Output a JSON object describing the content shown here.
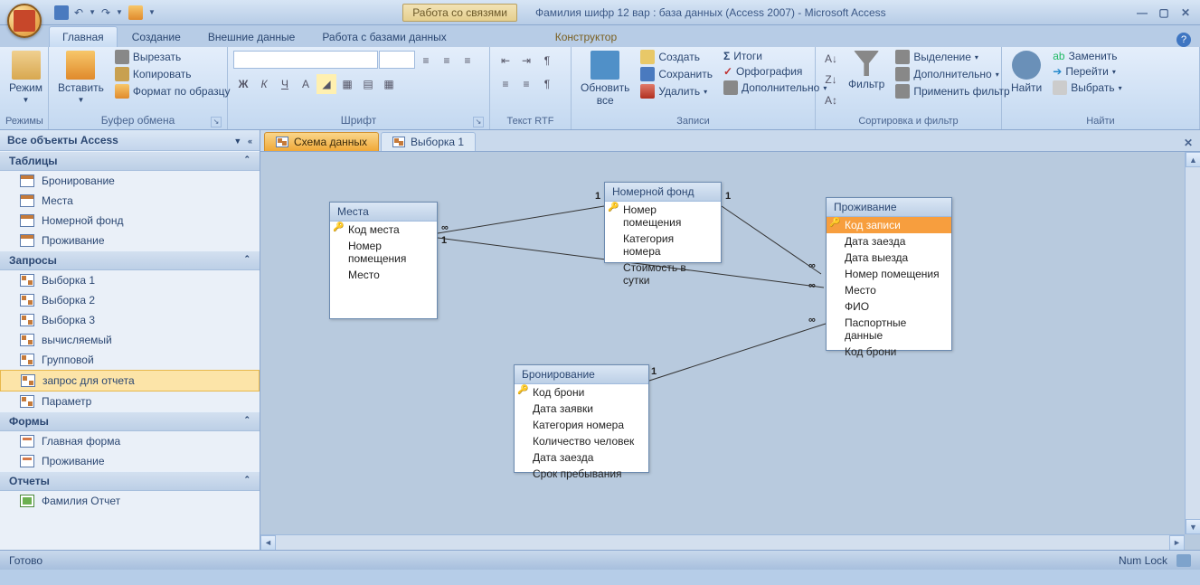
{
  "qat": {
    "save": "save-icon",
    "undo": "↶",
    "redo": "↷",
    "open": "open-icon"
  },
  "context_group": "Работа со связями",
  "app_title": "Фамилия шифр 12 вар : база данных (Access 2007)  -  Microsoft Access",
  "ribbon_tabs": [
    "Главная",
    "Создание",
    "Внешние данные",
    "Работа с базами данных"
  ],
  "ribbon_contextual": "Конструктор",
  "groups": {
    "modes": {
      "label": "Режимы",
      "btn": "Режим"
    },
    "clipboard": {
      "label": "Буфер обмена",
      "paste": "Вставить",
      "cut": "Вырезать",
      "copy": "Копировать",
      "fmt": "Формат по образцу"
    },
    "font": {
      "label": "Шрифт"
    },
    "rtf": {
      "label": "Текст RTF"
    },
    "records": {
      "label": "Записи",
      "refresh": "Обновить\nвсе",
      "new": "Создать",
      "save": "Сохранить",
      "delete": "Удалить",
      "totals": "Итоги",
      "spelling": "Орфография",
      "more": "Дополнительно"
    },
    "sort": {
      "label": "Сортировка и фильтр",
      "filter": "Фильтр",
      "selection": "Выделение",
      "advanced": "Дополнительно",
      "toggle": "Применить фильтр"
    },
    "find": {
      "label": "Найти",
      "find": "Найти",
      "replace": "Заменить",
      "goto": "Перейти",
      "select": "Выбрать"
    }
  },
  "nav": {
    "header": "Все объекты Access",
    "cats": {
      "tables": {
        "label": "Таблицы",
        "items": [
          "Бронирование",
          "Места",
          "Номерной фонд",
          "Проживание"
        ]
      },
      "queries": {
        "label": "Запросы",
        "items": [
          "Выборка 1",
          "Выборка 2",
          "Выборка 3",
          "вычисляемый",
          "Групповой",
          "запрос для отчета",
          "Параметр"
        ]
      },
      "forms": {
        "label": "Формы",
        "items": [
          "Главная форма",
          "Проживание"
        ]
      },
      "reports": {
        "label": "Отчеты",
        "items": [
          "Фамилия Отчет"
        ]
      }
    },
    "selected": "запрос для отчета"
  },
  "doc_tabs": [
    {
      "label": "Схема данных",
      "active": true
    },
    {
      "label": "Выборка 1",
      "active": false
    }
  ],
  "ertables": {
    "mesta": {
      "title": "Места",
      "fields": [
        {
          "n": "Код места",
          "pk": true
        },
        {
          "n": "Номер помещения"
        },
        {
          "n": "Место"
        }
      ]
    },
    "nomfond": {
      "title": "Номерной фонд",
      "fields": [
        {
          "n": "Номер помещения",
          "pk": true
        },
        {
          "n": "Категория номера"
        },
        {
          "n": "Стоимость в сутки"
        }
      ]
    },
    "bron": {
      "title": "Бронирование",
      "fields": [
        {
          "n": "Код брони",
          "pk": true
        },
        {
          "n": "Дата заявки"
        },
        {
          "n": "Категория номера"
        },
        {
          "n": "Количество человек"
        },
        {
          "n": "Дата заезда"
        },
        {
          "n": "Срок пребывания"
        }
      ]
    },
    "prozh": {
      "title": "Проживание",
      "fields": [
        {
          "n": "Код записи",
          "pk": true,
          "sel": true
        },
        {
          "n": "Дата заезда"
        },
        {
          "n": "Дата выезда"
        },
        {
          "n": "Номер помещения"
        },
        {
          "n": "Место"
        },
        {
          "n": "ФИО"
        },
        {
          "n": "Паспортные данные"
        },
        {
          "n": "Код брони"
        }
      ]
    }
  },
  "status": {
    "left": "Готово",
    "numlock": "Num Lock"
  }
}
